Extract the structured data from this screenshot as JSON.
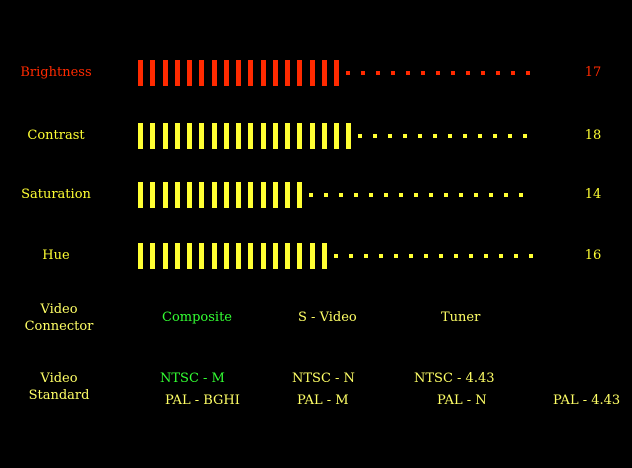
{
  "colors": {
    "background": "#000000",
    "active": "#ff2a00",
    "inactive": "#ffff33",
    "label_text": "#ffff66",
    "selected_option": "#33ff33"
  },
  "sliders": [
    {
      "id": "brightness",
      "label": "Brightness",
      "value": "17",
      "level": 17,
      "max": 32,
      "active": true
    },
    {
      "id": "contrast",
      "label": "Contrast",
      "value": "18",
      "level": 18,
      "max": 32,
      "active": false
    },
    {
      "id": "saturation",
      "label": "Saturation",
      "value": "14",
      "level": 14,
      "max": 32,
      "active": false
    },
    {
      "id": "hue",
      "label": "Hue",
      "value": "16",
      "level": 16,
      "max": 32,
      "active": false
    }
  ],
  "video_connector": {
    "label_line1": "Video",
    "label_line2": "Connector",
    "options": [
      "Composite",
      "S - Video",
      "Tuner"
    ],
    "selected": "Composite"
  },
  "video_standard": {
    "label_line1": "Video",
    "label_line2": "Standard",
    "row1": [
      "NTSC - M",
      "NTSC - N",
      "NTSC - 4.43"
    ],
    "row2": [
      "PAL - BGHI",
      "PAL - M",
      "PAL - N",
      "PAL - 4.43"
    ],
    "selected": "NTSC - M"
  }
}
